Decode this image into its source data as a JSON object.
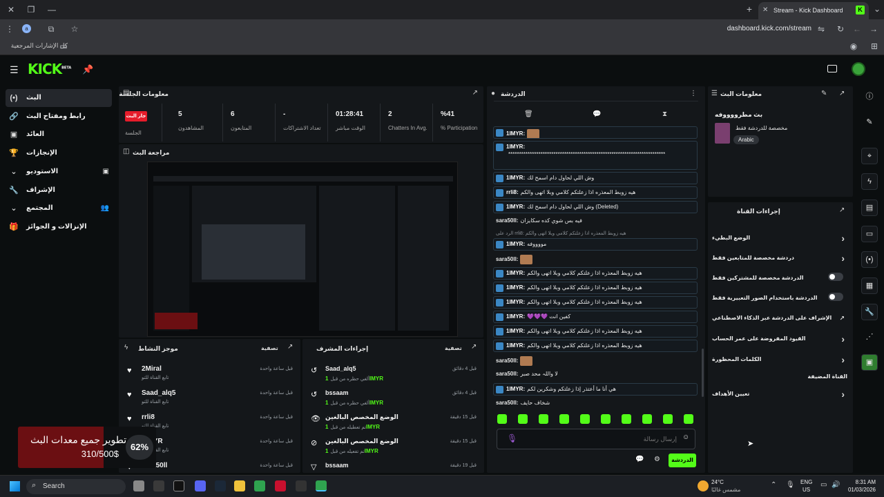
{
  "browser": {
    "tab_title": "Stream - Kick Dashboard",
    "url": "dashboard.kick.com/stream",
    "profile_letter": "a",
    "bookmarks_label": "كل الإشارات المرجعية"
  },
  "brand": {
    "logo": "KICK",
    "beta": "BETA",
    "accent": "#53fc18"
  },
  "sidebar": [
    {
      "label": "البث",
      "icon": "broadcast-icon",
      "glyph": "(•)"
    },
    {
      "label": "رابط ومفتاح البث",
      "icon": "link-icon",
      "glyph": "🔗"
    },
    {
      "label": "العائد",
      "icon": "money-icon",
      "glyph": "▣"
    },
    {
      "label": "الإنجازات",
      "icon": "trophy-icon",
      "glyph": "🏆"
    },
    {
      "label": "الاستوديو",
      "icon": "chevron-down-icon",
      "glyph": "⌄"
    },
    {
      "label": "الإشراف",
      "icon": "wrench-icon",
      "glyph": "🔧"
    },
    {
      "label": "المجتمع",
      "icon": "chevron-down-icon",
      "glyph": "⌄"
    },
    {
      "label": "الإنزالات و الجوائز",
      "icon": "gift-icon",
      "glyph": "🎁"
    }
  ],
  "session": {
    "title": "معلومات الجلسة",
    "live_badge": "جار البث",
    "session_label": "الجلسة",
    "stats": [
      {
        "value": "5",
        "label": "المشاهدون"
      },
      {
        "value": "6",
        "label": "المتابعون"
      },
      {
        "value": "-",
        "label": "تعداد الاشتراكات"
      },
      {
        "value": "01:28:41",
        "label": "الوقت مباشر"
      },
      {
        "value": "2",
        "label": "Chatters In Avg."
      },
      {
        "value": "%41",
        "label": "% Participation"
      }
    ]
  },
  "preview": {
    "title": "مراجعة البث"
  },
  "activity": {
    "title": "موجز النشاط",
    "filter": "تصفية",
    "items": [
      {
        "name": "2Miral",
        "sub": "تابع القناة للتو",
        "time": "قبل ساعة واحدة"
      },
      {
        "name": "Saad_alq5",
        "sub": "تابع القناة للتو",
        "time": "قبل ساعة واحدة"
      },
      {
        "name": "rrli8",
        "sub": "تابع القناة للتو",
        "time": "قبل ساعة واحدة"
      },
      {
        "name": "1IMYR",
        "sub": "تابع القناة للتو",
        "time": "قبل ساعة واحدة"
      },
      {
        "name": "sara50ll",
        "sub": "",
        "time": "قبل ساعة واحدة"
      }
    ]
  },
  "modactions": {
    "title": "إجراءات المشرف",
    "filter": "تصفية",
    "items": [
      {
        "name": "Saad_alq5",
        "by": "1IMYR",
        "action": "ألغي حظره من قبل",
        "time": "قبل 4 دقائق"
      },
      {
        "name": "bssaam",
        "by": "1IMYR",
        "action": "ألغي حظره من قبل",
        "time": "قبل 4 دقائق"
      },
      {
        "name": "الوضع المخصص البالغين",
        "by": "1IMYR",
        "action": "تم تعطيله من قبل",
        "time": "قبل 15 دقيقة"
      },
      {
        "name": "الوضع المخصص البالغين",
        "by": "1IMYR",
        "action": "تم تفعيله من قبل",
        "time": "قبل 15 دقيقة"
      },
      {
        "name": "bssaam",
        "by": "",
        "action": "",
        "time": "قبل 19 دقيقة"
      }
    ]
  },
  "chat": {
    "title": "الدردشة",
    "input_placeholder": "إرسال رسالة",
    "send_label": "الدردشة",
    "messages": [
      {
        "user": "1IMYR:",
        "text": "",
        "emote": true
      },
      {
        "user": "1IMYR:",
        "text": "*************************************************************************",
        "tall": true
      },
      {
        "user": "1IMYR:",
        "text": "وش اللي لحاول دام اسمح لك"
      },
      {
        "user": "rrli8:",
        "text": "هيه زوبط المعذره اذا زعلتكم كلامي وبلا اتهى والكم"
      },
      {
        "user": "1IMYR:",
        "text": "وش اللي لحاول دام اسمح لك (Deleted)"
      },
      {
        "user": "sara50ll:",
        "text": "فيه بس شوي كده سكايزان",
        "plain": true
      },
      {
        "user": "1IMYR:",
        "text": "مووووفه",
        "reply": "الرد على rrli8: هيه زوبط المعذره اذا زعلتكم كلامي وبلا اتهى والكم"
      },
      {
        "user": "sara50ll:",
        "text": "",
        "emote": true,
        "plain": true
      },
      {
        "user": "1IMYR:",
        "text": "هيه زوبط المعذره اذا زعلتكم كلامي وبلا اتهى والكم"
      },
      {
        "user": "1IMYR:",
        "text": "هيه زوبط المعذره اذا زعلتكم كلامي وبلا اتهى والكم"
      },
      {
        "user": "1IMYR:",
        "text": "هيه زوبط المعذره اذا زعلتكم كلامي وبلا اتهى والكم"
      },
      {
        "user": "1IMYR:",
        "text": "💜💜💜 كفين انت"
      },
      {
        "user": "1IMYR:",
        "text": "هيه زوبط المعذره اذا زعلتكم كلامي وبلا اتهى والكم"
      },
      {
        "user": "1IMYR:",
        "text": "هيه زوبط المعذره اذا زعلتكم كلامي وبلا اتهى والكم"
      },
      {
        "user": "sara50ll:",
        "text": "",
        "emote": true,
        "plain": true
      },
      {
        "user": "sara50ll:",
        "text": "لا واللہ محد صبر",
        "plain": true
      },
      {
        "user": "1IMYR:",
        "text": "هي أنا ما أعتذر إذا زعلتكم وشكرين لكم"
      },
      {
        "user": "sara50ll:",
        "text": "شخاف حايف",
        "plain": true
      }
    ]
  },
  "streaminfo": {
    "title": "معلومات البث",
    "stream_title": "بث مطرووووفه",
    "chat_mode": "مخصصة للدردشة فقط",
    "language": "Arabic"
  },
  "channel_actions": {
    "title": "إجراءات القناة",
    "items": [
      {
        "label": "الوضع البطيء",
        "control": "chevron"
      },
      {
        "label": "دردشة مخصصة للمتابعين فقط",
        "control": "chevron"
      },
      {
        "label": "الدردشة مخصصة للمشتركين فقط",
        "control": "toggle"
      },
      {
        "label": "الدردشة باستخدام الصور التعبيرية فقط",
        "control": "toggle"
      },
      {
        "label": "الإشراف على الدردشة عبر الذكاء الاصطناعي",
        "control": "external"
      },
      {
        "label": "القيود المفروضة على عمر الحساب",
        "control": "chevron"
      },
      {
        "label": "الكلمات المحظورة",
        "control": "chevron"
      },
      {
        "label": "القناة المضيفة",
        "control": "none"
      },
      {
        "label": "تعيين الأهداف",
        "control": "chevron"
      }
    ]
  },
  "goal": {
    "percent": "62%",
    "fraction": 0.62,
    "title": "تطوير جميع معدات البث",
    "amount": "310/500$"
  },
  "taskbar": {
    "search": "Search",
    "weather_temp": "24°C",
    "weather_text": "مشمس غالبًا",
    "lang": "ENG",
    "region": "US",
    "time": "8:31 AM",
    "date": "01/03/2026"
  }
}
